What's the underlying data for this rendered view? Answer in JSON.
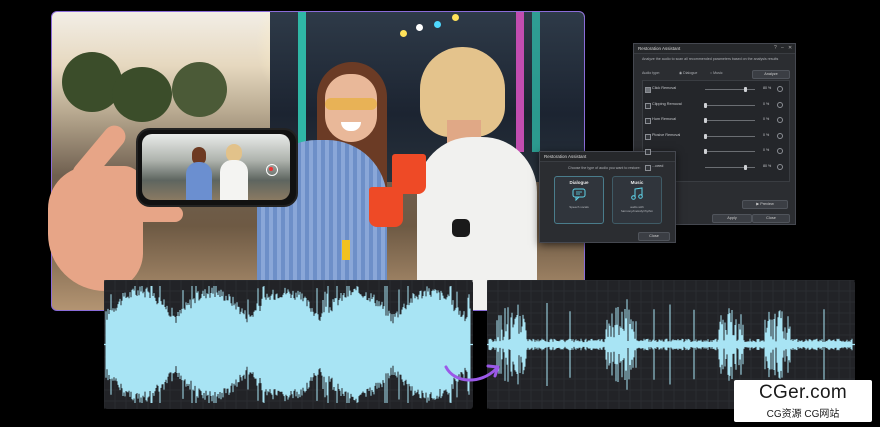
{
  "restoration_assistant": {
    "title": "Restoration Assistant",
    "window_controls": [
      "?",
      "–",
      "✕"
    ],
    "intro": "Analyze the audio to scan all recommended parameters based on the analysis results",
    "audio_type_label": "Audio type:",
    "audio_type_options": [
      "Dialogue",
      "Music"
    ],
    "analyze_label": "Analyze",
    "rows": [
      {
        "label": "Click Removal",
        "checked": true,
        "value": "80 %",
        "level": 0.8
      },
      {
        "label": "Clipping Removal",
        "checked": false,
        "value": "0 %",
        "level": 0
      },
      {
        "label": "Hum Removal",
        "checked": false,
        "value": "0 %",
        "level": 0
      },
      {
        "label": "Plosive Removal",
        "checked": false,
        "value": "0 %",
        "level": 0
      },
      {
        "label": "",
        "checked": false,
        "value": "0 %",
        "level": 0
      },
      {
        "label": "...ceed",
        "checked": false,
        "value": "80 %",
        "level": 0.8
      }
    ],
    "preview_label": "Preview",
    "apply_label": "Apply",
    "close_label": "Close"
  },
  "audio_type_dialog": {
    "title": "Restoration Assistant",
    "prompt": "Choose the type of audio you want to restore:",
    "cards": [
      {
        "name": "Dialogue",
        "desc": "Speech vocals",
        "icon": "speech-bubble-icon"
      },
      {
        "name": "Music",
        "desc": "audio with harmony/melody/rhythm",
        "icon": "music-note-icon"
      }
    ],
    "close_label": "Close"
  },
  "watermark": {
    "brand": "CGer.com",
    "sub": "CG资源  CG网站"
  },
  "colors": {
    "wave": "#a8e4f4",
    "panel": "#222327",
    "accent_border": "#8a6cd8",
    "arrow": "#9b59e8"
  }
}
